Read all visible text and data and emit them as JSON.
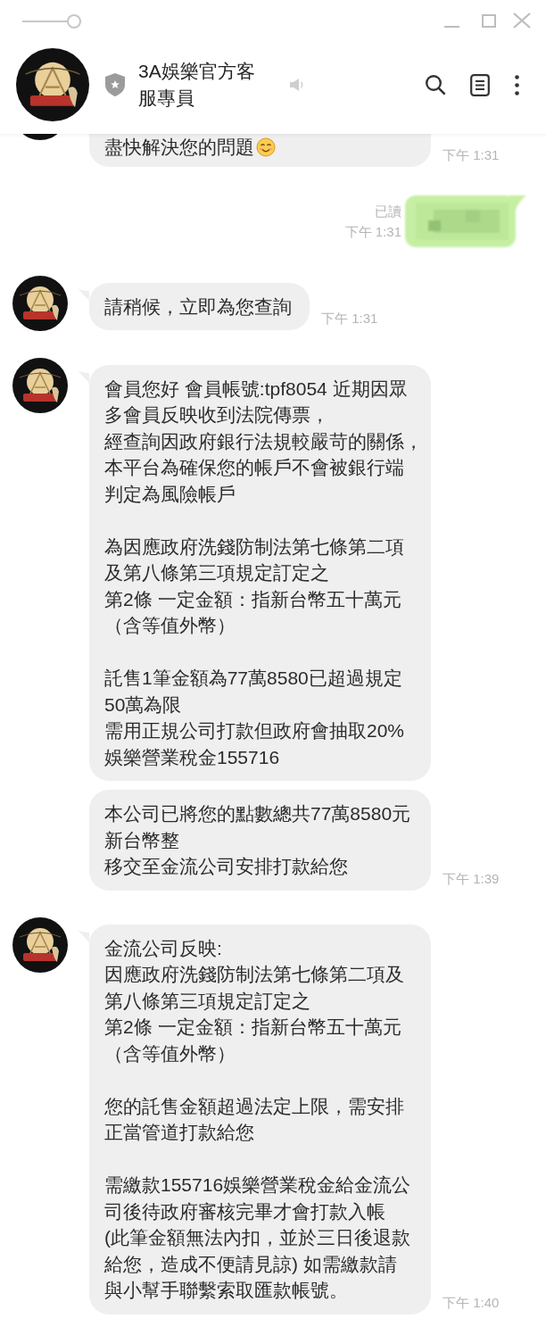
{
  "title_bar": {
    "slider": {
      "level": 1
    }
  },
  "header": {
    "title": "3A娛樂官方客服專員"
  },
  "groups": [
    {
      "kind": "incoming",
      "cut_off": true,
      "messages": [
        {
          "kind": "text",
          "paragraphs": [
            {
              "lines": [
                "盡快解決您的問題"
              ]
            }
          ],
          "emoji": true,
          "time": "下午 1:31"
        }
      ]
    },
    {
      "kind": "outgoing",
      "cut_off": false,
      "messages": [
        {
          "kind": "blurred",
          "read": "已讀",
          "time": "下午 1:31"
        }
      ]
    },
    {
      "kind": "incoming",
      "cut_off": false,
      "messages": [
        {
          "kind": "text",
          "paragraphs": [
            {
              "lines": [
                "請稍候，立即為您查詢"
              ]
            }
          ],
          "emoji": false,
          "time": "下午 1:31"
        }
      ]
    },
    {
      "kind": "incoming",
      "cut_off": false,
      "messages": [
        {
          "kind": "text",
          "paragraphs": [
            {
              "lines": [
                "會員您好 會員帳號:tpf8054 近期因眾多會員反映收到法院傳票，",
                "經查詢因政府銀行法規較嚴苛的關係，",
                "本平台為確保您的帳戶不會被銀行端判定為風險帳戶"
              ]
            },
            {
              "lines": [
                "為因應政府洗錢防制法第七條第二項及第八條第三項規定訂定之",
                "第2條 一定金額：指新台幣五十萬元（含等值外幣）"
              ]
            },
            {
              "lines": [
                "託售1筆金額為77萬8580已超過規定50萬為限",
                "需用正規公司打款但政府會抽取20%娛樂營業稅金155716"
              ]
            }
          ],
          "emoji": false
        },
        {
          "kind": "text",
          "paragraphs": [
            {
              "lines": [
                "本公司已將您的點數總共77萬8580元新台幣整",
                "移交至金流公司安排打款給您"
              ]
            }
          ],
          "emoji": false,
          "time": "下午 1:39"
        }
      ]
    },
    {
      "kind": "incoming",
      "cut_off": false,
      "messages": [
        {
          "kind": "text",
          "paragraphs": [
            {
              "lines": [
                "金流公司反映:",
                "因應政府洗錢防制法第七條第二項及第八條第三項規定訂定之",
                "第2條 一定金額：指新台幣五十萬元（含等值外幣）"
              ]
            },
            {
              "lines": [
                "您的託售金額超過法定上限，需安排正當管道打款給您"
              ]
            },
            {
              "lines": [
                "需繳款155716娛樂營業稅金給金流公司後待政府審核完畢才會打款入帳",
                "(此筆金額無法內扣，並於三日後退款給您，造成不便請見諒) 如需繳款請與小幫手聯繫索取匯款帳號。"
              ]
            }
          ],
          "emoji": false,
          "time": "下午 1:40"
        }
      ]
    }
  ]
}
